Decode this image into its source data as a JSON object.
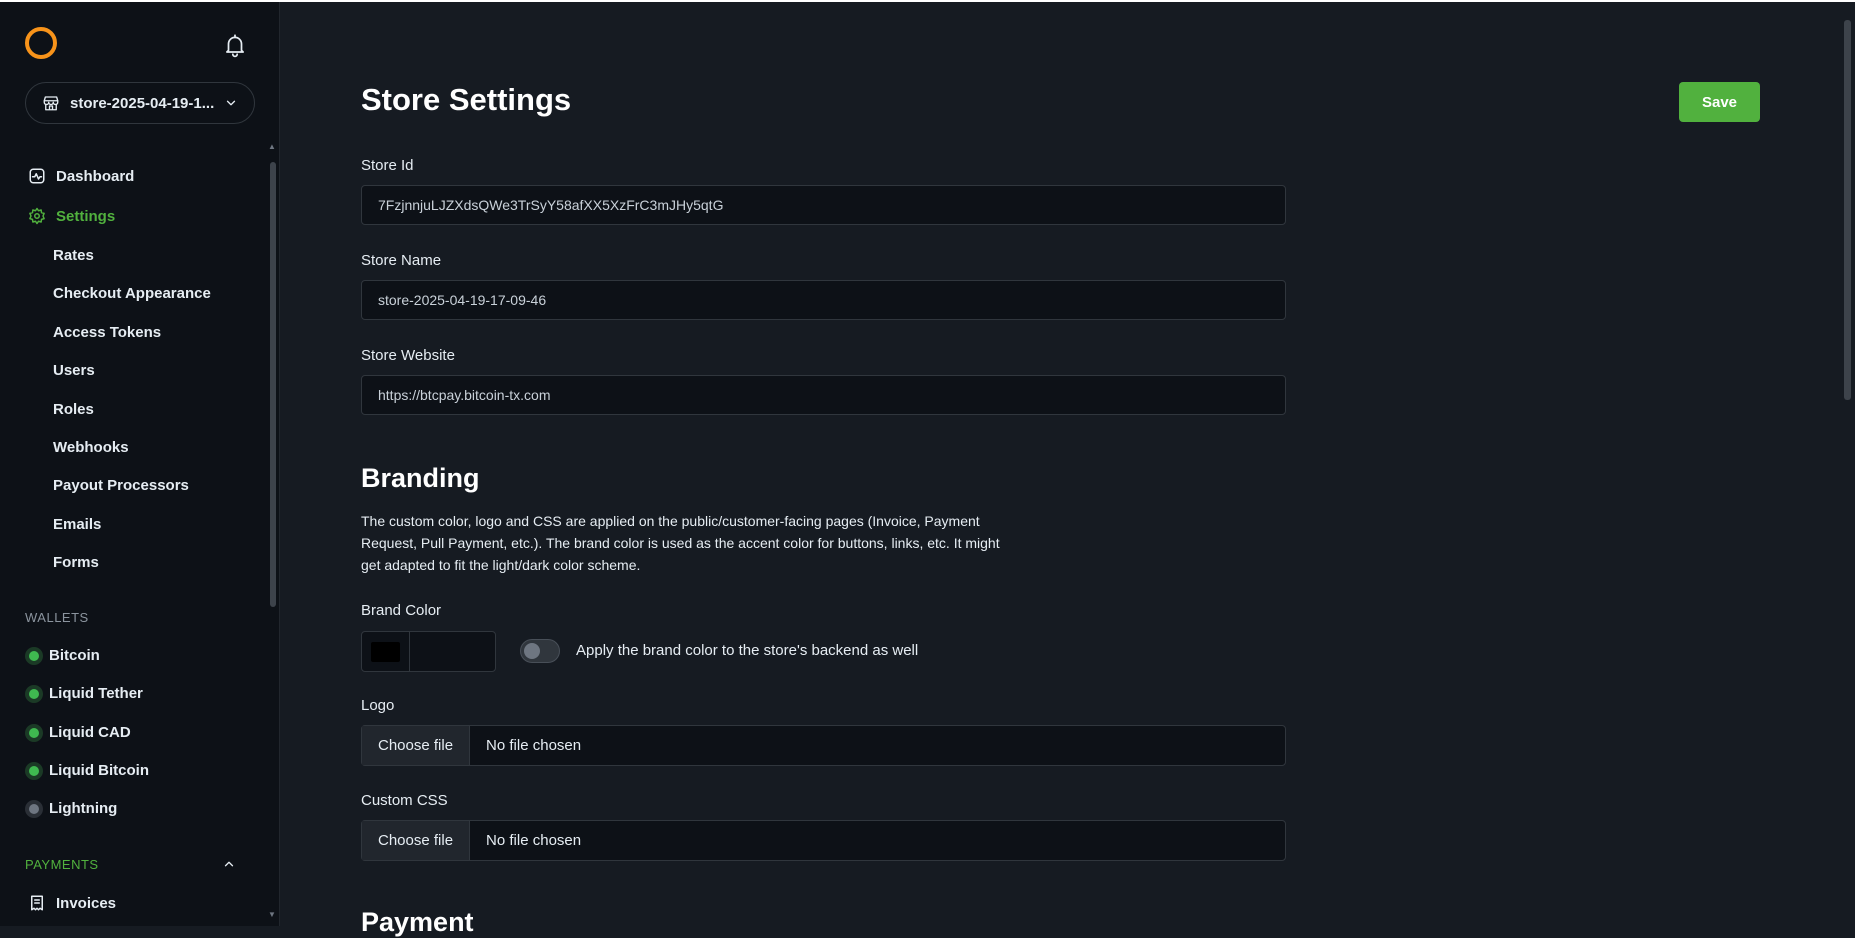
{
  "store_select": {
    "label": "store-2025-04-19-1..."
  },
  "nav": {
    "dashboard": "Dashboard",
    "settings": "Settings",
    "sub_items": [
      "Rates",
      "Checkout Appearance",
      "Access Tokens",
      "Users",
      "Roles",
      "Webhooks",
      "Payout Processors",
      "Emails",
      "Forms"
    ]
  },
  "wallets": {
    "heading": "WALLETS",
    "items": [
      {
        "label": "Bitcoin",
        "status": "active"
      },
      {
        "label": "Liquid Tether",
        "status": "active"
      },
      {
        "label": "Liquid CAD",
        "status": "active"
      },
      {
        "label": "Liquid Bitcoin",
        "status": "active"
      },
      {
        "label": "Lightning",
        "status": "inactive"
      }
    ]
  },
  "payments": {
    "heading": "PAYMENTS",
    "invoices": "Invoices"
  },
  "page": {
    "title": "Store Settings",
    "save_label": "Save",
    "store_id_label": "Store Id",
    "store_id_value": "7FzjnnjuLJZXdsQWe3TrSyY58afXX5XzFrC3mJHy5qtG",
    "store_name_label": "Store Name",
    "store_name_value": "store-2025-04-19-17-09-46",
    "store_website_label": "Store Website",
    "store_website_value": "https://btcpay.bitcoin-tx.com"
  },
  "branding": {
    "heading": "Branding",
    "description": "The custom color, logo and CSS are applied on the public/customer-facing pages (Invoice, Payment Request, Pull Payment, etc.). The brand color is used as the accent color for buttons, links, etc. It might get adapted to fit the light/dark color scheme.",
    "brand_color_label": "Brand Color",
    "brand_color_value": "#000000",
    "toggle_label": "Apply the brand color to the store's backend as well",
    "toggle_on": false,
    "logo_label": "Logo",
    "css_label": "Custom CSS",
    "choose_file": "Choose file",
    "no_file": "No file chosen"
  },
  "payment": {
    "heading": "Payment"
  },
  "colors": {
    "accent": "#51b13e",
    "logo": "#f7931a",
    "background": "#161b22",
    "sidebar": "#0d1117"
  }
}
